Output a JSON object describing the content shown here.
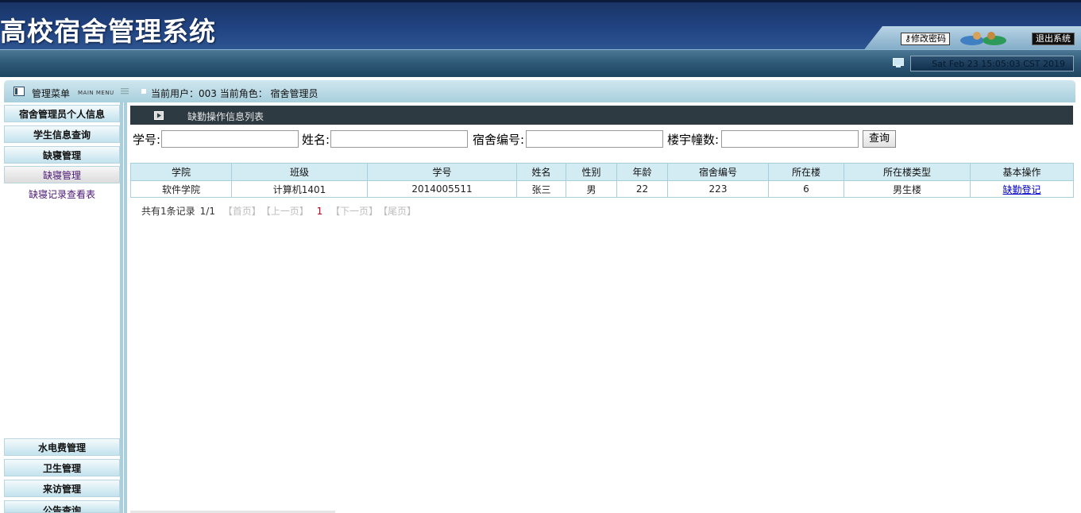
{
  "app": {
    "title": "高校宿舍管理系统"
  },
  "header": {
    "change_password": "修改密码",
    "logout": "退出系统",
    "datetime": "Sat Feb 23 15:05:03 CST 2019"
  },
  "menubar": {
    "title": "管理菜单",
    "subtitle": "MAIN MENU",
    "user_info": "当前用户：003   当前角色： 宿舍管理员"
  },
  "sidebar": {
    "items": [
      {
        "label": "宿舍管理员个人信息"
      },
      {
        "label": "学生信息查询"
      },
      {
        "label": "缺寝管理"
      },
      {
        "label": "缺寝管理"
      },
      {
        "label": "缺寝记录查看表"
      },
      {
        "label": "水电费管理"
      },
      {
        "label": "卫生管理"
      },
      {
        "label": "来访管理"
      },
      {
        "label": "公告查询"
      }
    ]
  },
  "content": {
    "header": "缺勤操作信息列表",
    "search": {
      "fields": [
        {
          "label": "学号:"
        },
        {
          "label": "姓名:"
        },
        {
          "label": "宿舍编号:"
        },
        {
          "label": "楼宇幢数:"
        }
      ],
      "button": "查询"
    },
    "table": {
      "columns": [
        "学院",
        "班级",
        "学号",
        "姓名",
        "性别",
        "年龄",
        "宿舍编号",
        "所在楼",
        "所在楼类型",
        "基本操作"
      ],
      "rows": [
        [
          "软件学院",
          "计算机1401",
          "2014005511",
          "张三",
          "男",
          "22",
          "223",
          "6",
          "男生楼",
          "缺勤登记"
        ]
      ]
    },
    "pager": {
      "summary": "共有1条记录",
      "page": "1/1",
      "first": "【首页】",
      "prev": "【上一页】",
      "current": "1",
      "next": "【下一页】",
      "last": "【尾页】"
    }
  },
  "colors": {
    "header_bg": "#214382",
    "accent_light": "#d3ebf2",
    "link": "#0000cc",
    "current_page": "#b3001b"
  }
}
